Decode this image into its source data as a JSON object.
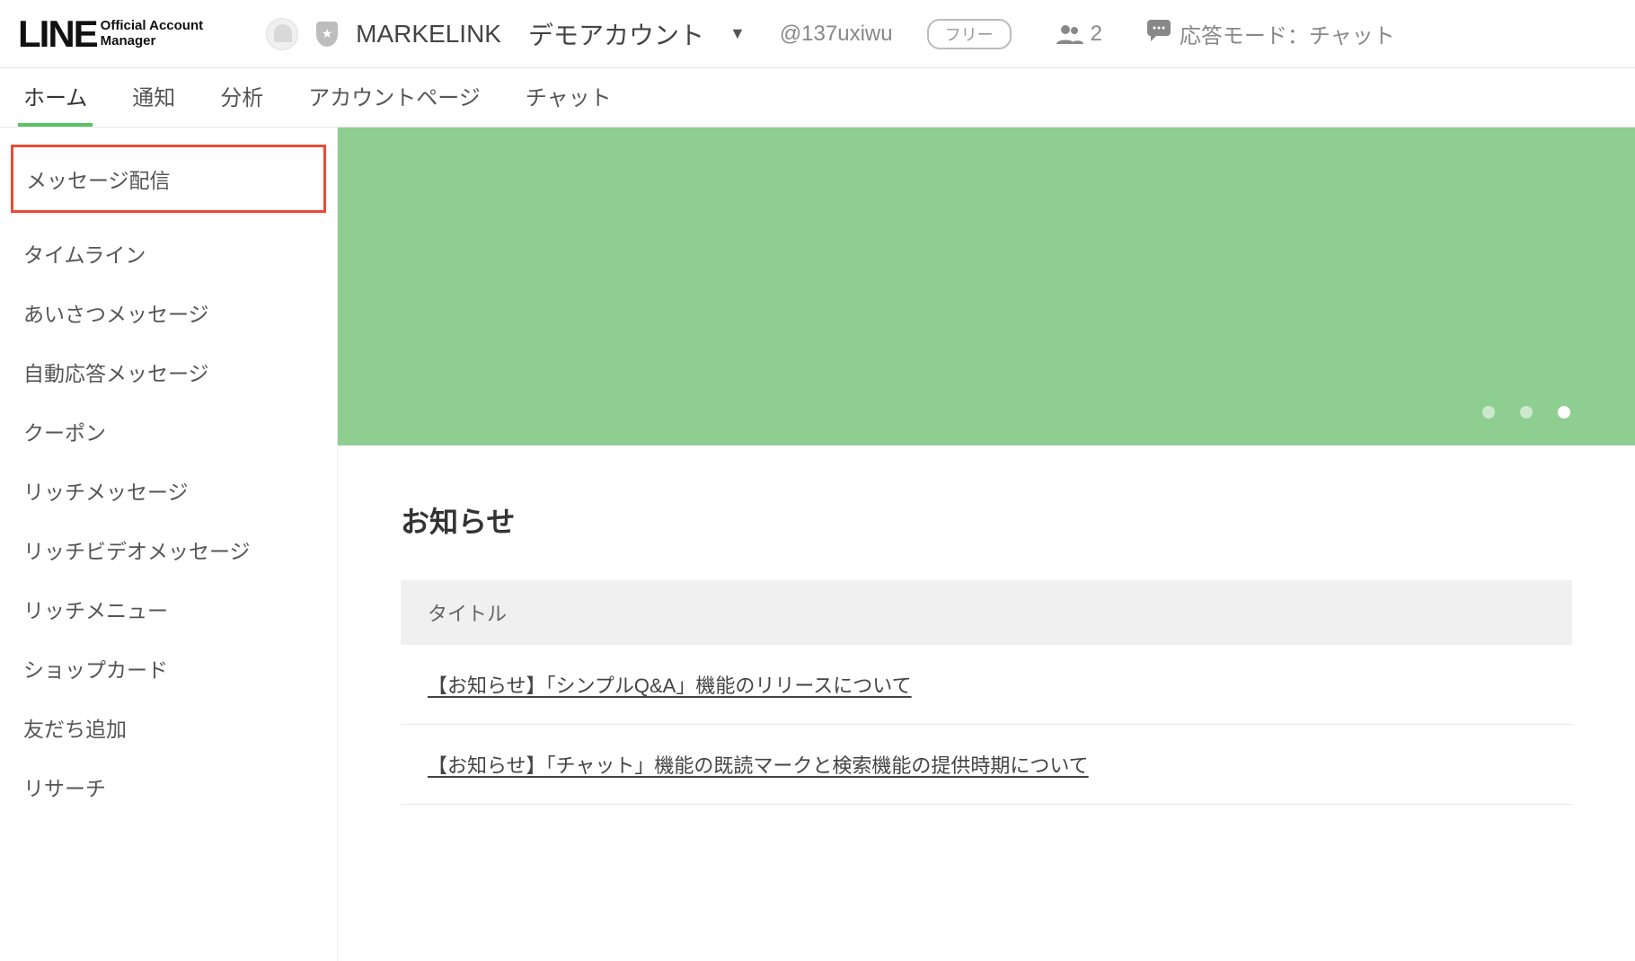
{
  "header": {
    "logo_primary": "LINE",
    "logo_secondary_line1": "Official Account",
    "logo_secondary_line2": "Manager",
    "account_display": "MARKELINK",
    "account_sub": "デモアカウント",
    "account_id": "@137uxiwu",
    "plan_label": "フリー",
    "friend_count": "2",
    "reply_mode_label": "応答モード：チャット"
  },
  "tabs": [
    {
      "label": "ホーム",
      "active": true
    },
    {
      "label": "通知",
      "active": false
    },
    {
      "label": "分析",
      "active": false
    },
    {
      "label": "アカウントページ",
      "active": false
    },
    {
      "label": "チャット",
      "active": false
    }
  ],
  "sidebar": {
    "items": [
      {
        "label": "メッセージ配信",
        "highlight": true
      },
      {
        "label": "タイムライン"
      },
      {
        "label": "あいさつメッセージ"
      },
      {
        "label": "自動応答メッセージ"
      },
      {
        "label": "クーポン"
      },
      {
        "label": "リッチメッセージ"
      },
      {
        "label": "リッチビデオメッセージ"
      },
      {
        "label": "リッチメニュー"
      },
      {
        "label": "ショップカード"
      },
      {
        "label": "友だち追加"
      },
      {
        "label": "リサーチ"
      }
    ]
  },
  "banner": {
    "dot_count": 3,
    "active_dot": 2
  },
  "news": {
    "section_title": "お知らせ",
    "column_header": "タイトル",
    "rows": [
      {
        "title": "【お知らせ】「シンプルQ&A」機能のリリースについて"
      },
      {
        "title": "【お知らせ】「チャット」機能の既読マークと検索機能の提供時期について"
      }
    ]
  }
}
